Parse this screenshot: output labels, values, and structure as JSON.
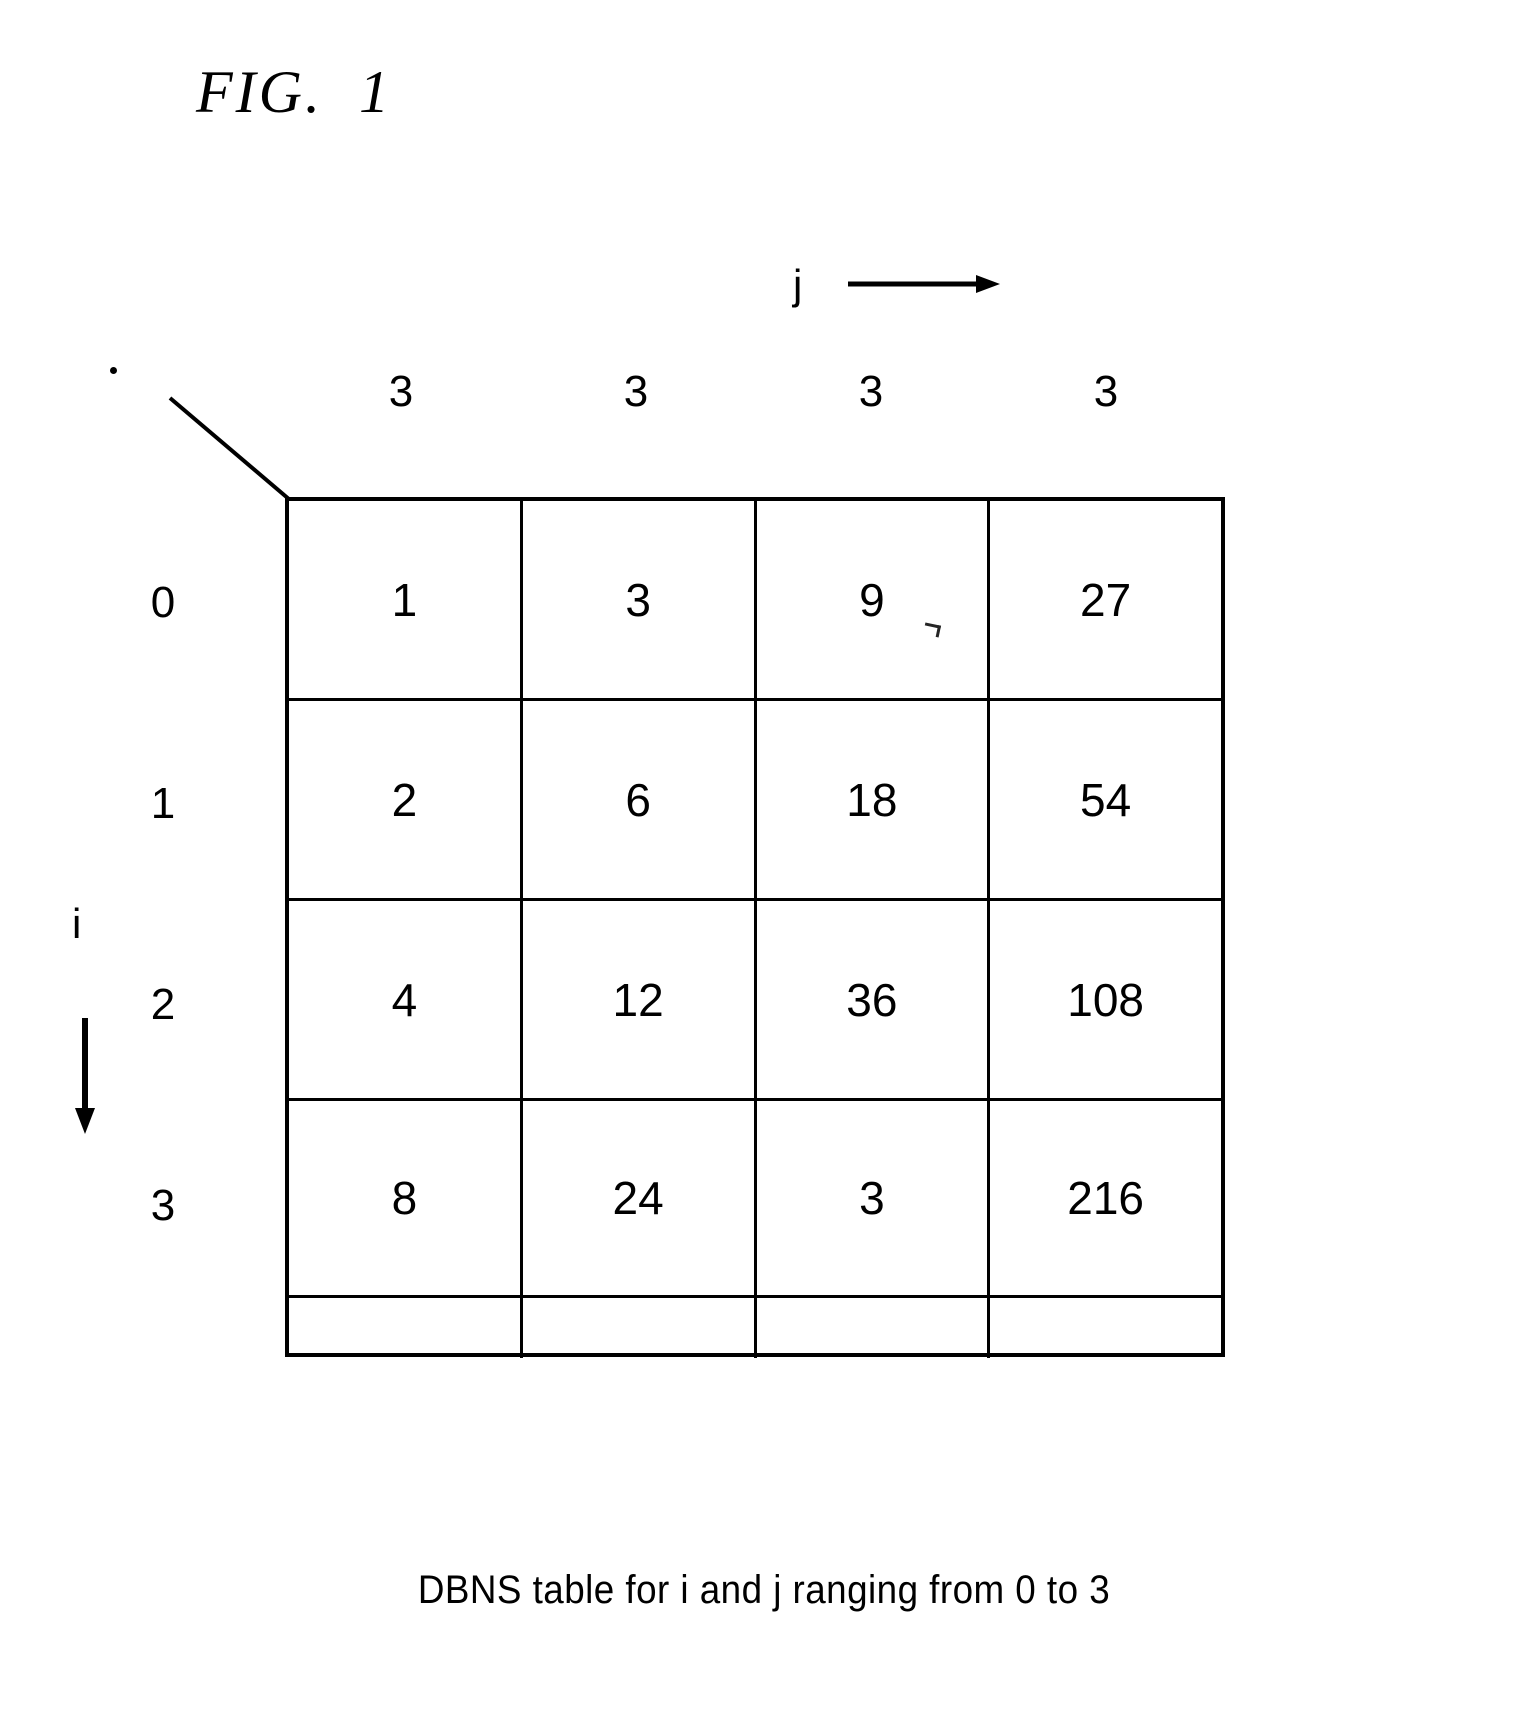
{
  "figure": {
    "title": "FIG.  1",
    "caption": "DBNS table for i and j ranging from 0 to 3"
  },
  "axes": {
    "column_axis_label": "j",
    "row_axis_label": "i",
    "column_arrow_icon": "arrow-right-icon",
    "row_arrow_icon": "arrow-down-icon"
  },
  "chart_data": {
    "type": "table",
    "title": "DBNS table for i and j ranging from 0 to 3",
    "xlabel": "j",
    "ylabel": "i",
    "column_headers": [
      "3",
      "3",
      "3",
      "3"
    ],
    "row_headers": [
      "0",
      "1",
      "2",
      "3"
    ],
    "rows": [
      [
        "1",
        "3",
        "9",
        "27"
      ],
      [
        "2",
        "6",
        "18",
        "54"
      ],
      [
        "4",
        "12",
        "36",
        "108"
      ],
      [
        "8",
        "24",
        "3",
        "216"
      ]
    ],
    "grid": true,
    "legend": "none"
  },
  "colors": {
    "ink": "#000000",
    "paper": "#ffffff"
  }
}
